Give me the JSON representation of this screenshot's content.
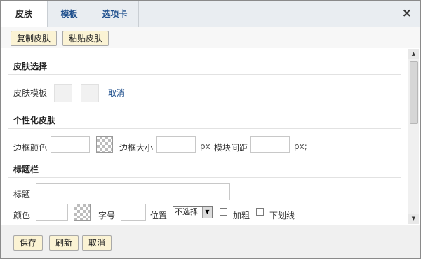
{
  "tabs": [
    {
      "label": "皮肤",
      "active": true
    },
    {
      "label": "模板",
      "active": false
    },
    {
      "label": "选项卡",
      "active": false
    }
  ],
  "close_glyph": "×",
  "toolbar": {
    "copy_label": "复制皮肤",
    "paste_label": "粘贴皮肤"
  },
  "skin_select": {
    "title": "皮肤选择",
    "template_label": "皮肤模板",
    "cancel_link": "取消"
  },
  "custom_skin": {
    "title": "个性化皮肤",
    "border_color_label": "边框颜色",
    "border_size_label": "边框大小",
    "border_size_unit": "px",
    "module_spacing_label": "模块间距",
    "module_spacing_unit": "px;"
  },
  "title_bar": {
    "title": "标题栏",
    "title_label": "标题",
    "color_label": "颜色",
    "font_size_label": "字号",
    "position_label": "位置",
    "position_select": {
      "value": "不选择"
    },
    "bold_label": "加粗",
    "underline_label": "下划线"
  },
  "footer": {
    "save_label": "保存",
    "refresh_label": "刷新",
    "cancel_label": "取消"
  },
  "colors": {
    "tab_link": "#1d4e8c",
    "button_bg": "#fbf3d4"
  },
  "icons": {
    "close": "close-icon",
    "color_picker": "color-picker-icon",
    "dropdown": "chevron-down-icon"
  }
}
